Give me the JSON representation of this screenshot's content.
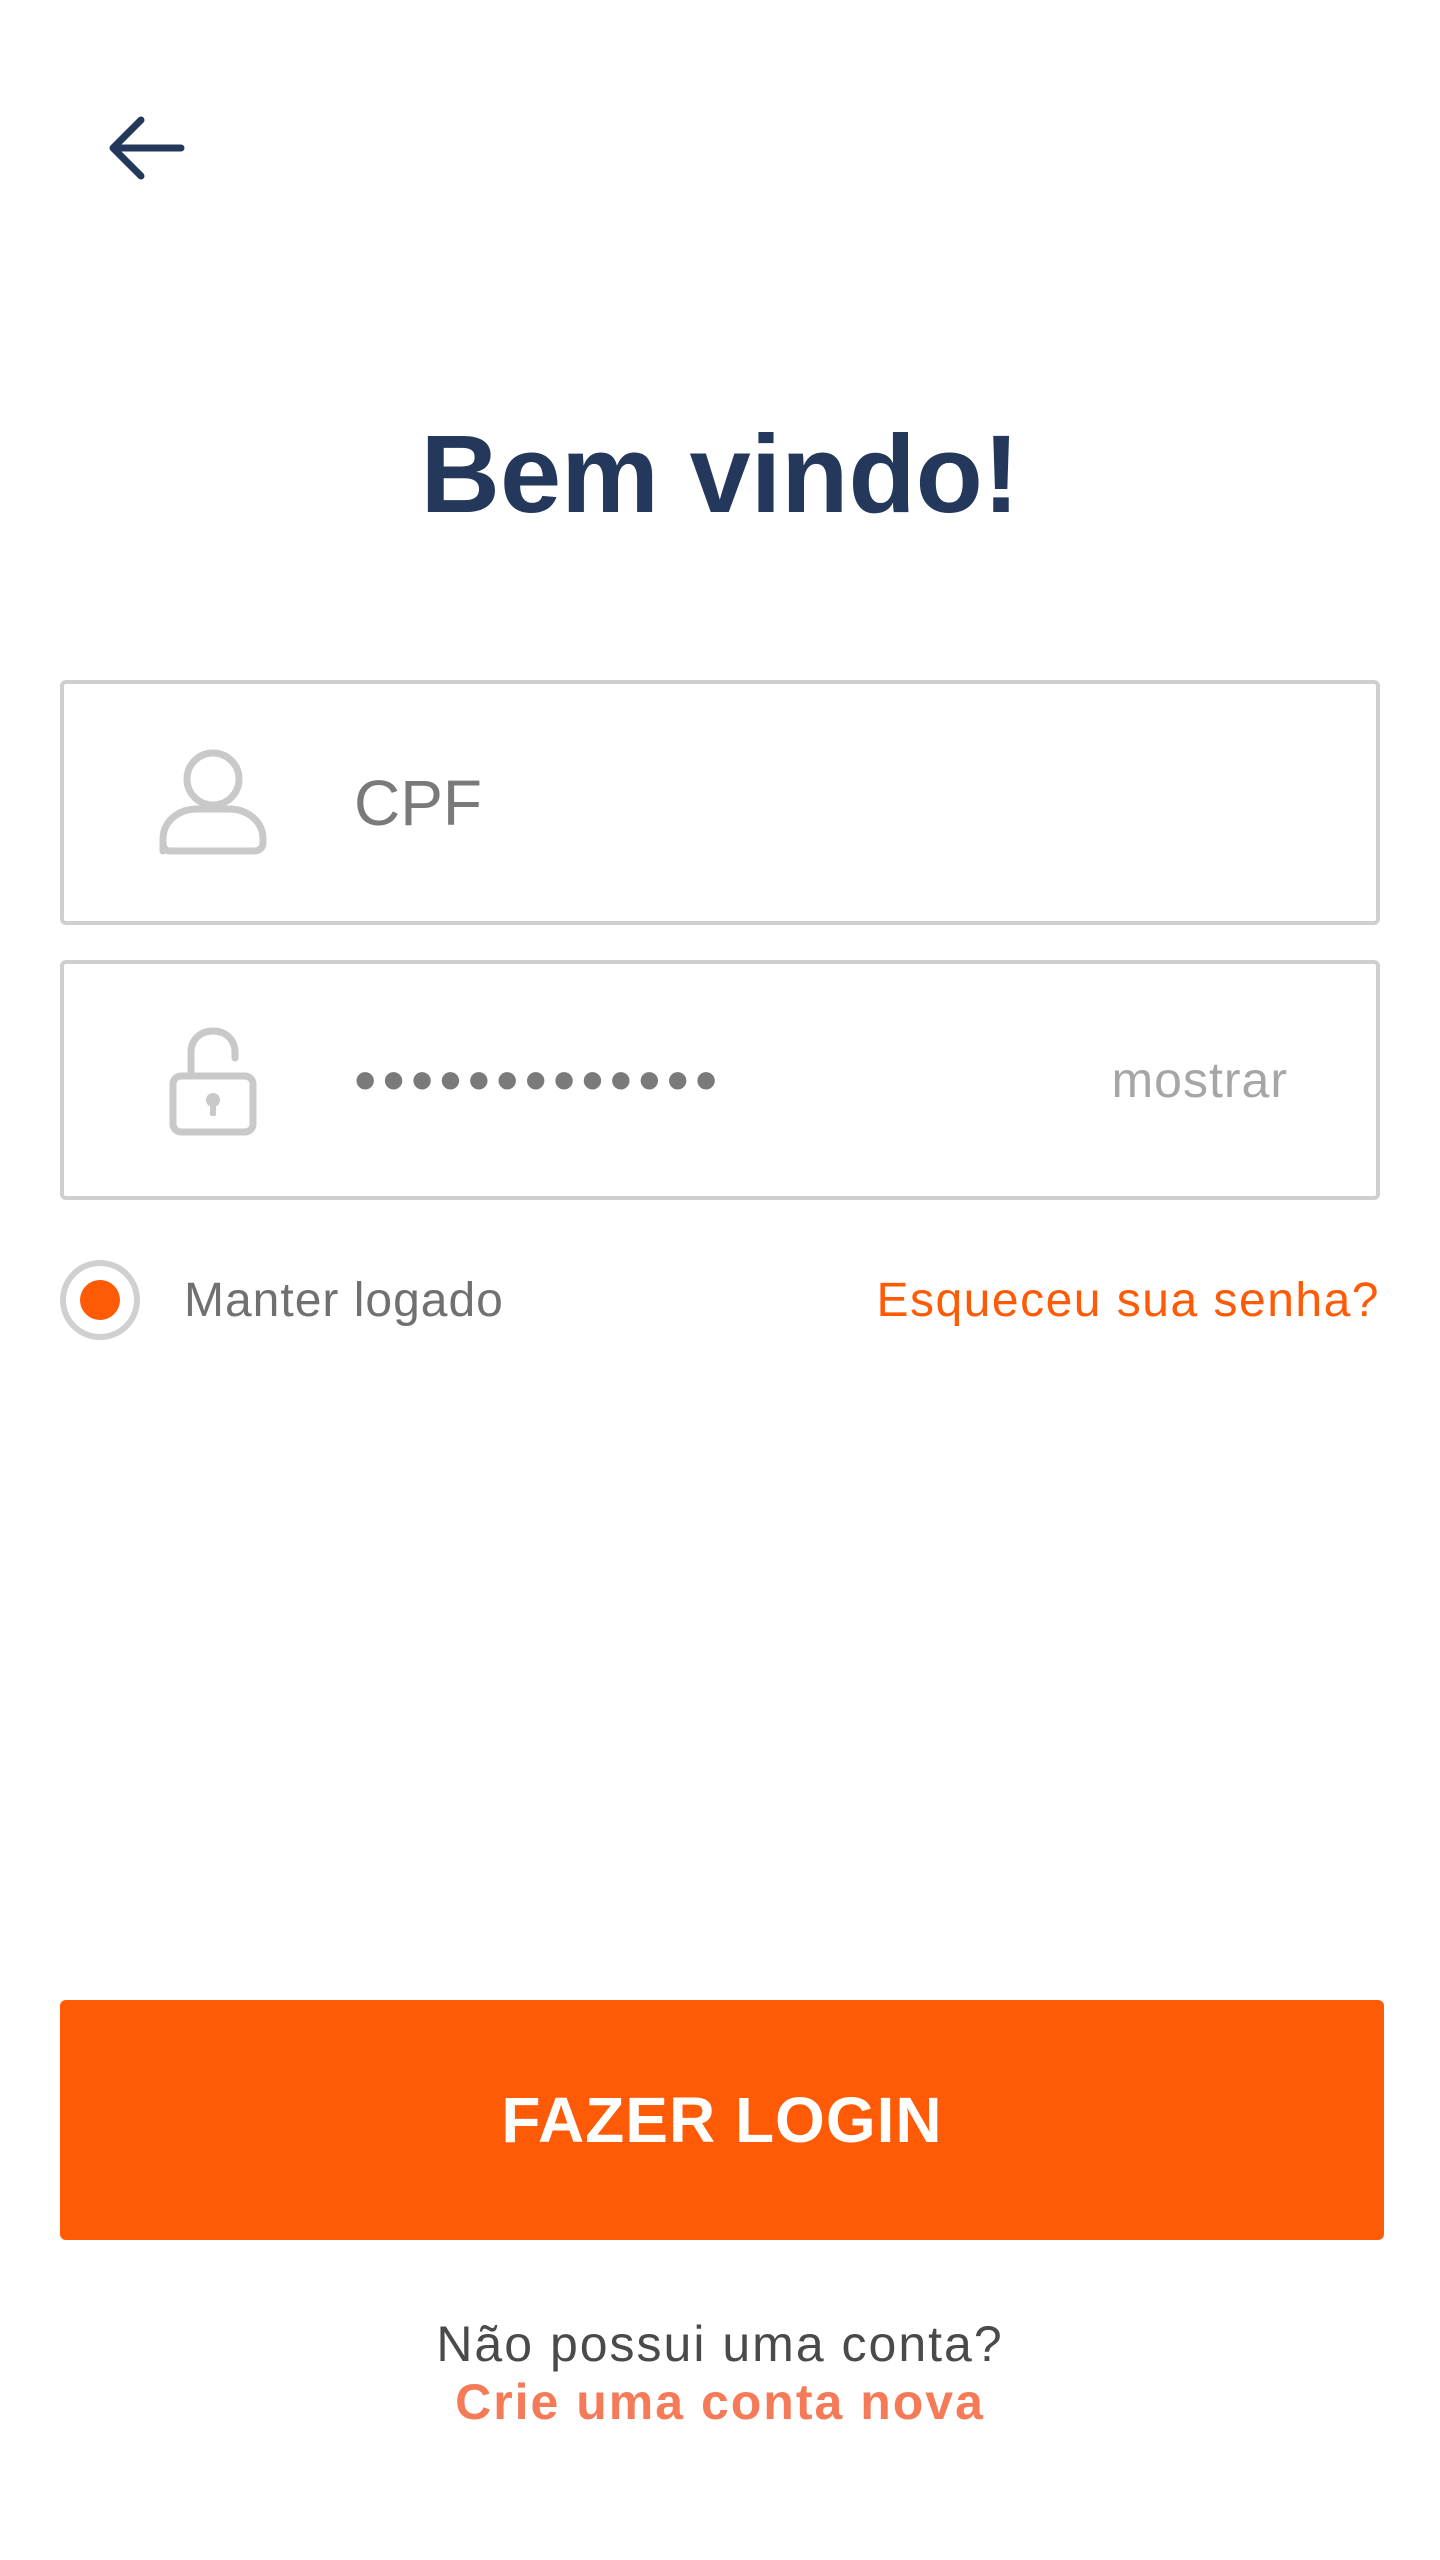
{
  "header": {
    "back_icon": "arrow-left-icon"
  },
  "title": "Bem vindo!",
  "form": {
    "cpf": {
      "icon": "user-icon",
      "placeholder": "CPF",
      "value": ""
    },
    "password": {
      "icon": "lock-icon",
      "masked_value": "•••••••••••••",
      "show_label": "mostrar"
    },
    "remember_me": {
      "label": "Manter logado",
      "checked": true
    },
    "forgot_password_label": "Esqueceu sua senha?"
  },
  "actions": {
    "login_label": "FAZER LOGIN"
  },
  "footer": {
    "no_account_text": "Não possui uma conta?",
    "create_account_label": "Crie uma conta nova"
  },
  "colors": {
    "accent": "#ff5a05",
    "title": "#24385b",
    "link_soft": "#f57b58",
    "border": "#cfcfcf"
  }
}
